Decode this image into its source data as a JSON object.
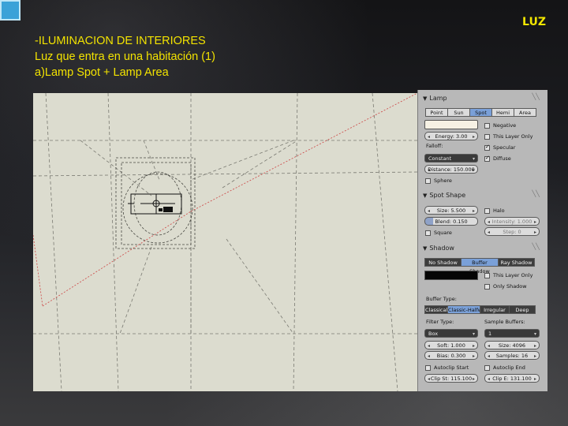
{
  "slide": {
    "corner_label": "LUZ",
    "title_lines": [
      "-ILUMINACION DE INTERIORES",
      "Luz que entra en una habitación (1)",
      "a)Lamp Spot  + Lamp Area"
    ]
  },
  "colors": {
    "accent_text": "#f3e300",
    "viewport_bg": "#dcdccf",
    "panel_bg": "#b8b8b8",
    "selected_btn": "#7aa0d8"
  },
  "lamp": {
    "header": "Lamp",
    "types": [
      "Point",
      "Sun",
      "Spot",
      "Hemi",
      "Area"
    ],
    "selected_type": "Spot",
    "energy": "Energy: 3.00",
    "options": [
      "Negative",
      "This Layer Only",
      "Specular",
      "Diffuse"
    ],
    "options_checked": [
      false,
      false,
      true,
      true
    ],
    "falloff_label": "Falloff:",
    "falloff_value": "Constant",
    "distance": "Distance: 150.000",
    "sphere": "Sphere"
  },
  "spot_shape": {
    "header": "Spot Shape",
    "size": "Size: 5.500",
    "blend": "Blend: 0.150",
    "square": "Square",
    "halo": "Halo",
    "intensity": "Intensity: 1.000",
    "step": "Step: 0"
  },
  "shadow": {
    "header": "Shadow",
    "modes": [
      "No Shadow",
      "Buffer Shadow",
      "Ray Shadow"
    ],
    "selected_mode": "Buffer Shadow",
    "this_layer_only": "This Layer Only",
    "only_shadow": "Only Shadow",
    "buffer_type_label": "Buffer Type:",
    "buffer_types": [
      "Classical",
      "Classic-Halfway",
      "Irregular",
      "Deep"
    ],
    "selected_buffer": "Classic-Halfway",
    "filter_type_label": "Filter Type:",
    "filter_value": "Box",
    "sample_buffers_label": "Sample Buffers:",
    "sample_buffers_value": "1",
    "soft": "Soft: 1.000",
    "bias": "Bias: 0.300",
    "size": "Size: 4096",
    "samples": "Samples: 16",
    "autoclip_start": "Autoclip Start",
    "autoclip_end": "Autoclip End",
    "clip_start": "Clip St: 115.100",
    "clip_end": "Clip E: 131.100"
  }
}
